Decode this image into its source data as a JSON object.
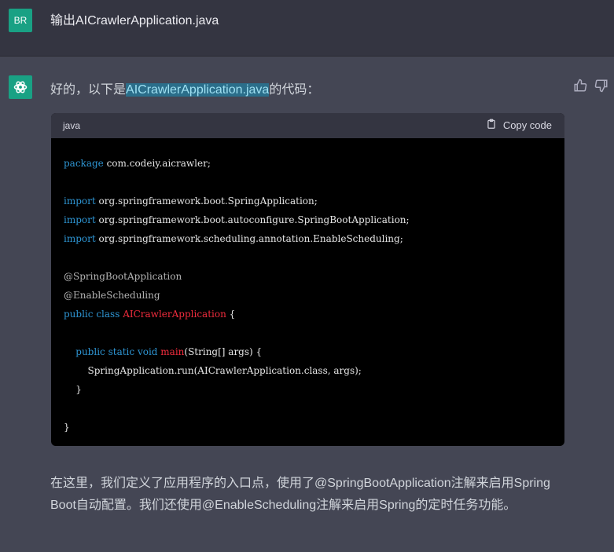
{
  "user_message": {
    "avatar_text": "BR",
    "text": "输出AICrawlerApplication.java"
  },
  "assistant": {
    "intro_before": "好的，以下是",
    "intro_highlight": "AICrawlerApplication.java",
    "intro_after": "的代码：",
    "code_block": {
      "language": "java",
      "copy_label": "Copy code",
      "lines": [
        {
          "parts": [
            {
              "t": "package",
              "c": "kw"
            },
            {
              "t": " com.codeiy.aicrawler;",
              "c": ""
            }
          ]
        },
        {
          "parts": []
        },
        {
          "parts": [
            {
              "t": "import",
              "c": "kw"
            },
            {
              "t": " org.springframework.boot.SpringApplication;",
              "c": ""
            }
          ]
        },
        {
          "parts": [
            {
              "t": "import",
              "c": "kw"
            },
            {
              "t": " org.springframework.boot.autoconfigure.SpringBootApplication;",
              "c": ""
            }
          ]
        },
        {
          "parts": [
            {
              "t": "import",
              "c": "kw"
            },
            {
              "t": " org.springframework.scheduling.annotation.EnableScheduling;",
              "c": ""
            }
          ]
        },
        {
          "parts": []
        },
        {
          "parts": [
            {
              "t": "@SpringBootApplication",
              "c": "an"
            }
          ]
        },
        {
          "parts": [
            {
              "t": "@EnableScheduling",
              "c": "an"
            }
          ]
        },
        {
          "parts": [
            {
              "t": "public",
              "c": "kw"
            },
            {
              "t": " ",
              "c": ""
            },
            {
              "t": "class",
              "c": "kw"
            },
            {
              "t": " ",
              "c": ""
            },
            {
              "t": "AICrawlerApplication",
              "c": "fn"
            },
            {
              "t": " {",
              "c": ""
            }
          ]
        },
        {
          "parts": []
        },
        {
          "parts": [
            {
              "t": "    ",
              "c": ""
            },
            {
              "t": "public",
              "c": "kw"
            },
            {
              "t": " ",
              "c": ""
            },
            {
              "t": "static",
              "c": "kw"
            },
            {
              "t": " ",
              "c": ""
            },
            {
              "t": "void",
              "c": "kw"
            },
            {
              "t": " ",
              "c": ""
            },
            {
              "t": "main",
              "c": "fn"
            },
            {
              "t": "(String[] args) {",
              "c": ""
            }
          ]
        },
        {
          "parts": [
            {
              "t": "        SpringApplication.run(AICrawlerApplication.class, args);",
              "c": ""
            }
          ]
        },
        {
          "parts": [
            {
              "t": "    }",
              "c": ""
            }
          ]
        },
        {
          "parts": []
        },
        {
          "parts": [
            {
              "t": "}",
              "c": ""
            }
          ]
        }
      ]
    },
    "outro": "在这里，我们定义了应用程序的入口点，使用了@SpringBootApplication注解来启用Spring Boot自动配置。我们还使用@EnableScheduling注解来启用Spring的定时任务功能。"
  }
}
